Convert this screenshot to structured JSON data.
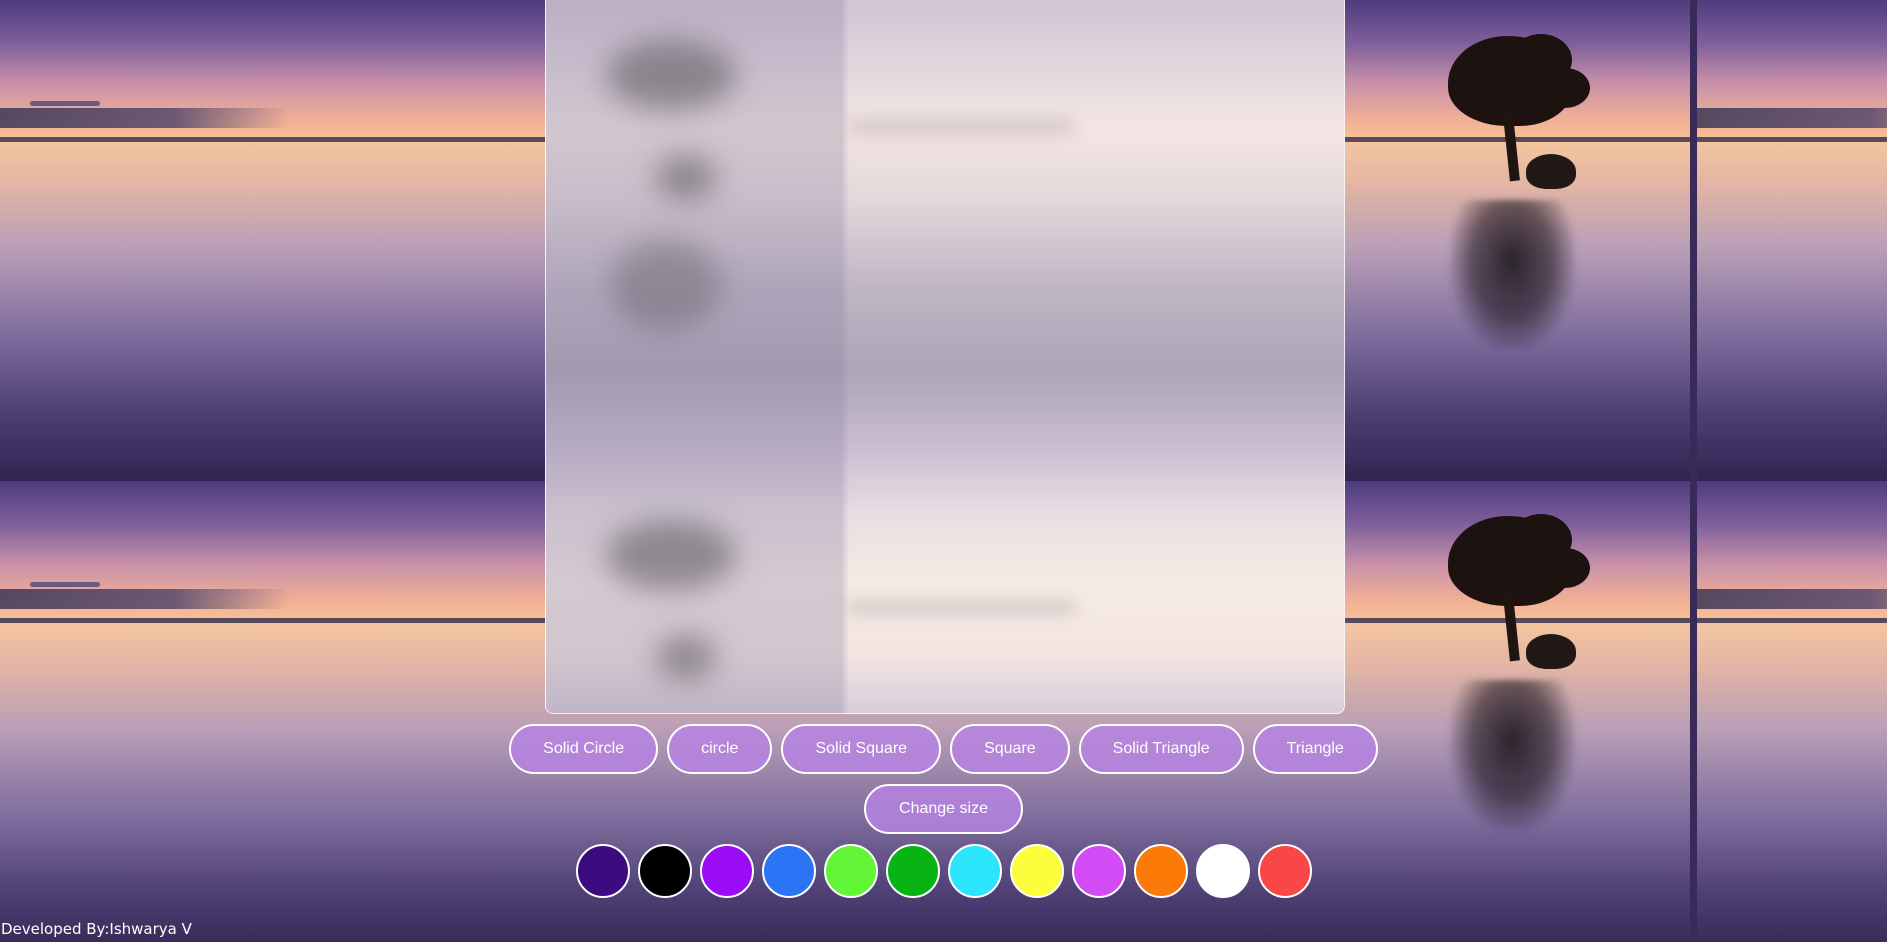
{
  "shape_buttons": [
    {
      "label": "Solid Circle"
    },
    {
      "label": "circle"
    },
    {
      "label": "Solid Square"
    },
    {
      "label": "Square"
    },
    {
      "label": "Solid Triangle"
    },
    {
      "label": "Triangle"
    }
  ],
  "size_button": {
    "label": "Change size"
  },
  "palette": [
    {
      "name": "indigo",
      "color": "#3d0a80"
    },
    {
      "name": "black",
      "color": "#000000"
    },
    {
      "name": "violet",
      "color": "#9a0cf5"
    },
    {
      "name": "blue",
      "color": "#2b74f6"
    },
    {
      "name": "lime",
      "color": "#62f535"
    },
    {
      "name": "green",
      "color": "#07b414"
    },
    {
      "name": "cyan",
      "color": "#2ae5fb"
    },
    {
      "name": "yellow",
      "color": "#fcfd3b"
    },
    {
      "name": "orchid",
      "color": "#d14cf5"
    },
    {
      "name": "orange",
      "color": "#fb7a08"
    },
    {
      "name": "white",
      "color": "#ffffff"
    },
    {
      "name": "red",
      "color": "#f94747"
    }
  ],
  "footer": {
    "credit": "Developed By:Ishwarya V"
  }
}
